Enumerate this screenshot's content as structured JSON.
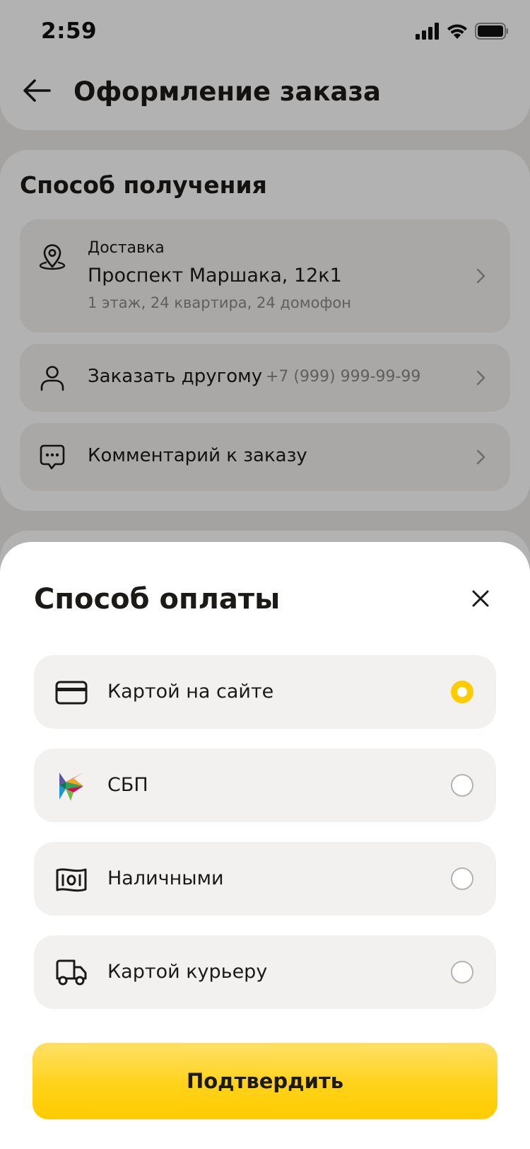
{
  "status_bar": {
    "time": "2:59",
    "icons": [
      "signal-icon",
      "wifi-icon",
      "battery-icon"
    ]
  },
  "header": {
    "back_icon": "arrow-left-icon",
    "title": "Оформление заказа"
  },
  "receipt_section": {
    "title": "Способ получения",
    "delivery": {
      "icon": "location-pin-icon",
      "label": "Доставка",
      "address": "Проспект Маршака, 12к1",
      "details": "1 этаж, 24 квартира, 24 домофон"
    },
    "order_for_other": {
      "icon": "person-icon",
      "label": "Заказать другому",
      "phone": "+7 (999) 999-99-99"
    },
    "comment": {
      "icon": "chat-bubble-icon",
      "label": "Комментарий к заказу"
    }
  },
  "payment_sheet": {
    "title": "Способ оплаты",
    "close_icon": "close-icon",
    "options": [
      {
        "label": "Картой на сайте",
        "icon": "credit-card-icon",
        "selected": true
      },
      {
        "label": "СБП",
        "icon": "sbp-logo-icon",
        "selected": false
      },
      {
        "label": "Наличными",
        "icon": "cash-icon",
        "selected": false
      },
      {
        "label": "Картой курьеру",
        "icon": "delivery-truck-icon",
        "selected": false
      }
    ],
    "confirm_label": "Подтвердить"
  },
  "colors": {
    "accent": "#ffcc00",
    "card_background": "#f2f1ef",
    "text_primary": "#1c1a17",
    "text_secondary": "#8a8884"
  }
}
